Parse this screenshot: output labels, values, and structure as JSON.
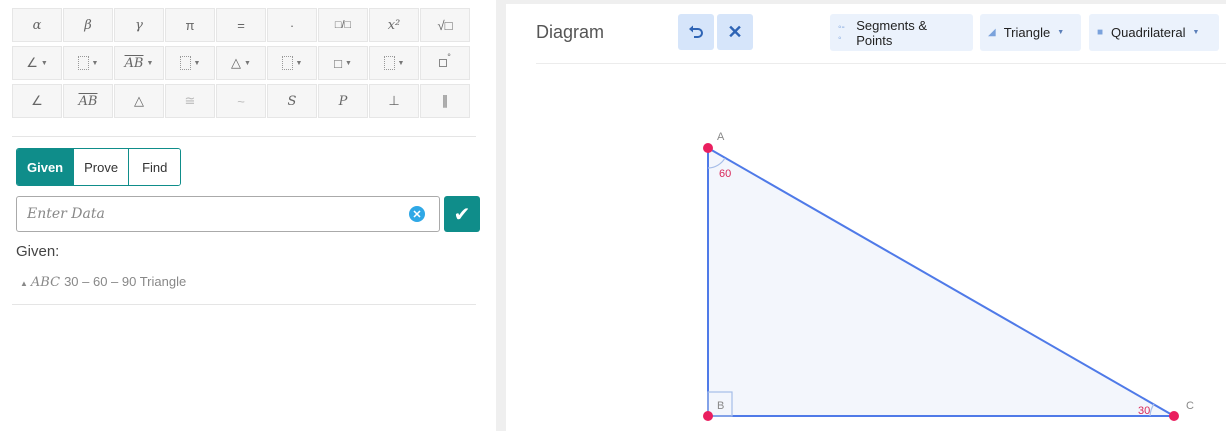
{
  "keypad": {
    "row1": [
      "α",
      "β",
      "γ",
      "π",
      "=",
      "·",
      "□/□",
      "x²",
      "√□"
    ],
    "row2": [
      "∠",
      "⋮",
      "AB",
      "⋮",
      "△",
      "⋮",
      "□",
      "⋮",
      "□°"
    ],
    "row3": [
      "∠",
      "AB",
      "△",
      "≅",
      "~",
      "S",
      "P",
      "⊥",
      "∥"
    ]
  },
  "tabs": {
    "given": "Given",
    "prove": "Prove",
    "find": "Find"
  },
  "input": {
    "placeholder": "Enter Data"
  },
  "given": {
    "heading": "Given:",
    "item_symbol": "▲",
    "item_name": "ABC",
    "item_text": "30 – 60 – 90 Triangle"
  },
  "diagram": {
    "title": "Diagram",
    "undo_icon": "undo-icon",
    "close_icon": "close-icon",
    "segments_label": "Segments & Points",
    "triangle_label": "Triangle",
    "quadrilateral_label": "Quadrilateral",
    "labels": {
      "A": "A",
      "B": "B",
      "C": "C"
    },
    "angle_A": "60",
    "angle_C": "30",
    "colors": {
      "edge": "#4f7ae8",
      "point": "#ea1f5f",
      "fill": "#f3f6fc",
      "angle_text": "#d9285a"
    }
  }
}
